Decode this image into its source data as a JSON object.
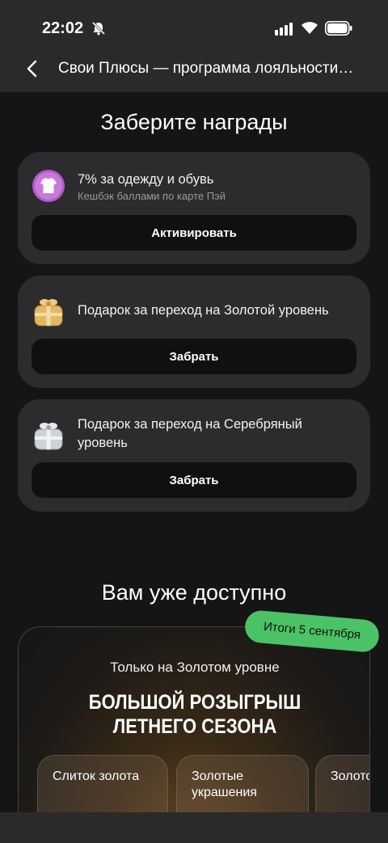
{
  "status": {
    "time": "22:02"
  },
  "header": {
    "title": "Свои Плюсы — программа лояльности…"
  },
  "rewards_section": {
    "title": "Заберите награды",
    "cards": [
      {
        "title": "7% за одежду и обувь",
        "subtitle": "Кешбэк баллами по карте Пэй",
        "button": "Активировать",
        "icon": "tshirt-icon"
      },
      {
        "title": "Подарок за переход на Золотой уровень",
        "button": "Забрать",
        "icon": "gold-gift-icon"
      },
      {
        "title": "Подарок за переход на Серебряный уровень",
        "button": "Забрать",
        "icon": "silver-gift-icon"
      }
    ]
  },
  "available_section": {
    "title": "Вам уже доступно",
    "promo": {
      "badge": "Итоги 5 сентября",
      "subtitle": "Только на Золотом уровне",
      "headline_line1": "БОЛЬШОЙ РОЗЫГРЫШ",
      "headline_line2": "ЛЕТНЕГО СЕЗОНА",
      "prizes": [
        "Слиток золота",
        "Золотые украшения",
        "Золото на Ай"
      ]
    }
  },
  "colors": {
    "background": "#151515",
    "card": "#2c2c2e",
    "accent_green": "#4cc266",
    "button": "#101010"
  }
}
